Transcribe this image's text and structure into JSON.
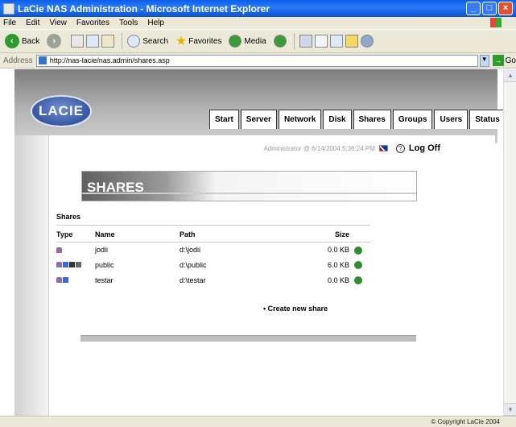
{
  "window": {
    "title": "LaCie NAS Administration - Microsoft Internet Explorer"
  },
  "menu": [
    "File",
    "Edit",
    "View",
    "Favorites",
    "Tools",
    "Help"
  ],
  "toolbar": {
    "back": "Back",
    "search": "Search",
    "favorites": "Favorites",
    "media": "Media"
  },
  "address": {
    "label": "Address",
    "url": "http://nas-lacie/nas.admin/shares.asp",
    "go": "Go"
  },
  "logo": "LACIE",
  "tabs": [
    "Start",
    "Server",
    "Network",
    "Disk",
    "Shares",
    "Groups",
    "Users",
    "Status"
  ],
  "userline": {
    "text": "Administrator @ 6/14/2004 5:36:24 PM",
    "logoff": "Log Off",
    "help": "?"
  },
  "page": {
    "banner": "SHARES",
    "section": "Shares",
    "create_link": "• Create new share"
  },
  "table": {
    "headers": [
      "Type",
      "Name",
      "Path",
      "Size"
    ],
    "rows": [
      {
        "name": "jodii",
        "path": "d:\\jodii",
        "size": "0.0 KB"
      },
      {
        "name": "public",
        "path": "d:\\public",
        "size": "6.0 KB"
      },
      {
        "name": "testar",
        "path": "d:\\testar",
        "size": "0.0 KB"
      }
    ]
  },
  "status": {
    "copyright": "© Copyright LaCie 2004"
  },
  "colors": {
    "title_blue": "#0a5ee8",
    "header_gray": "#9a9a9a",
    "edit_green": "#2e8b2e"
  }
}
